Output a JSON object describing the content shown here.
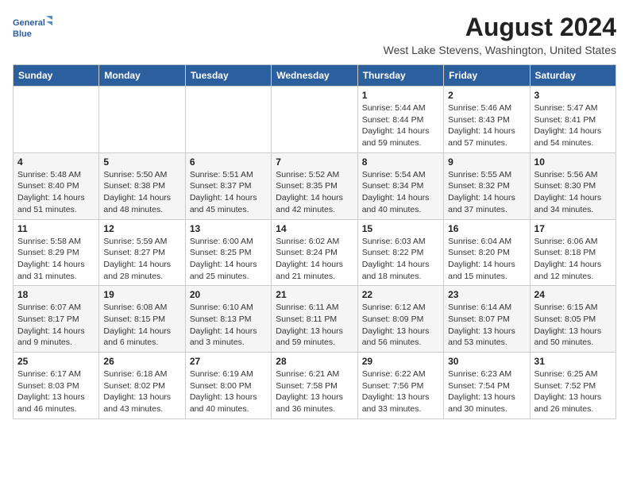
{
  "logo": {
    "line1": "General",
    "line2": "Blue"
  },
  "title": "August 2024",
  "subtitle": "West Lake Stevens, Washington, United States",
  "weekdays": [
    "Sunday",
    "Monday",
    "Tuesday",
    "Wednesday",
    "Thursday",
    "Friday",
    "Saturday"
  ],
  "weeks": [
    [
      {
        "day": "",
        "info": ""
      },
      {
        "day": "",
        "info": ""
      },
      {
        "day": "",
        "info": ""
      },
      {
        "day": "",
        "info": ""
      },
      {
        "day": "1",
        "info": "Sunrise: 5:44 AM\nSunset: 8:44 PM\nDaylight: 14 hours\nand 59 minutes."
      },
      {
        "day": "2",
        "info": "Sunrise: 5:46 AM\nSunset: 8:43 PM\nDaylight: 14 hours\nand 57 minutes."
      },
      {
        "day": "3",
        "info": "Sunrise: 5:47 AM\nSunset: 8:41 PM\nDaylight: 14 hours\nand 54 minutes."
      }
    ],
    [
      {
        "day": "4",
        "info": "Sunrise: 5:48 AM\nSunset: 8:40 PM\nDaylight: 14 hours\nand 51 minutes."
      },
      {
        "day": "5",
        "info": "Sunrise: 5:50 AM\nSunset: 8:38 PM\nDaylight: 14 hours\nand 48 minutes."
      },
      {
        "day": "6",
        "info": "Sunrise: 5:51 AM\nSunset: 8:37 PM\nDaylight: 14 hours\nand 45 minutes."
      },
      {
        "day": "7",
        "info": "Sunrise: 5:52 AM\nSunset: 8:35 PM\nDaylight: 14 hours\nand 42 minutes."
      },
      {
        "day": "8",
        "info": "Sunrise: 5:54 AM\nSunset: 8:34 PM\nDaylight: 14 hours\nand 40 minutes."
      },
      {
        "day": "9",
        "info": "Sunrise: 5:55 AM\nSunset: 8:32 PM\nDaylight: 14 hours\nand 37 minutes."
      },
      {
        "day": "10",
        "info": "Sunrise: 5:56 AM\nSunset: 8:30 PM\nDaylight: 14 hours\nand 34 minutes."
      }
    ],
    [
      {
        "day": "11",
        "info": "Sunrise: 5:58 AM\nSunset: 8:29 PM\nDaylight: 14 hours\nand 31 minutes."
      },
      {
        "day": "12",
        "info": "Sunrise: 5:59 AM\nSunset: 8:27 PM\nDaylight: 14 hours\nand 28 minutes."
      },
      {
        "day": "13",
        "info": "Sunrise: 6:00 AM\nSunset: 8:25 PM\nDaylight: 14 hours\nand 25 minutes."
      },
      {
        "day": "14",
        "info": "Sunrise: 6:02 AM\nSunset: 8:24 PM\nDaylight: 14 hours\nand 21 minutes."
      },
      {
        "day": "15",
        "info": "Sunrise: 6:03 AM\nSunset: 8:22 PM\nDaylight: 14 hours\nand 18 minutes."
      },
      {
        "day": "16",
        "info": "Sunrise: 6:04 AM\nSunset: 8:20 PM\nDaylight: 14 hours\nand 15 minutes."
      },
      {
        "day": "17",
        "info": "Sunrise: 6:06 AM\nSunset: 8:18 PM\nDaylight: 14 hours\nand 12 minutes."
      }
    ],
    [
      {
        "day": "18",
        "info": "Sunrise: 6:07 AM\nSunset: 8:17 PM\nDaylight: 14 hours\nand 9 minutes."
      },
      {
        "day": "19",
        "info": "Sunrise: 6:08 AM\nSunset: 8:15 PM\nDaylight: 14 hours\nand 6 minutes."
      },
      {
        "day": "20",
        "info": "Sunrise: 6:10 AM\nSunset: 8:13 PM\nDaylight: 14 hours\nand 3 minutes."
      },
      {
        "day": "21",
        "info": "Sunrise: 6:11 AM\nSunset: 8:11 PM\nDaylight: 13 hours\nand 59 minutes."
      },
      {
        "day": "22",
        "info": "Sunrise: 6:12 AM\nSunset: 8:09 PM\nDaylight: 13 hours\nand 56 minutes."
      },
      {
        "day": "23",
        "info": "Sunrise: 6:14 AM\nSunset: 8:07 PM\nDaylight: 13 hours\nand 53 minutes."
      },
      {
        "day": "24",
        "info": "Sunrise: 6:15 AM\nSunset: 8:05 PM\nDaylight: 13 hours\nand 50 minutes."
      }
    ],
    [
      {
        "day": "25",
        "info": "Sunrise: 6:17 AM\nSunset: 8:03 PM\nDaylight: 13 hours\nand 46 minutes."
      },
      {
        "day": "26",
        "info": "Sunrise: 6:18 AM\nSunset: 8:02 PM\nDaylight: 13 hours\nand 43 minutes."
      },
      {
        "day": "27",
        "info": "Sunrise: 6:19 AM\nSunset: 8:00 PM\nDaylight: 13 hours\nand 40 minutes."
      },
      {
        "day": "28",
        "info": "Sunrise: 6:21 AM\nSunset: 7:58 PM\nDaylight: 13 hours\nand 36 minutes."
      },
      {
        "day": "29",
        "info": "Sunrise: 6:22 AM\nSunset: 7:56 PM\nDaylight: 13 hours\nand 33 minutes."
      },
      {
        "day": "30",
        "info": "Sunrise: 6:23 AM\nSunset: 7:54 PM\nDaylight: 13 hours\nand 30 minutes."
      },
      {
        "day": "31",
        "info": "Sunrise: 6:25 AM\nSunset: 7:52 PM\nDaylight: 13 hours\nand 26 minutes."
      }
    ]
  ]
}
